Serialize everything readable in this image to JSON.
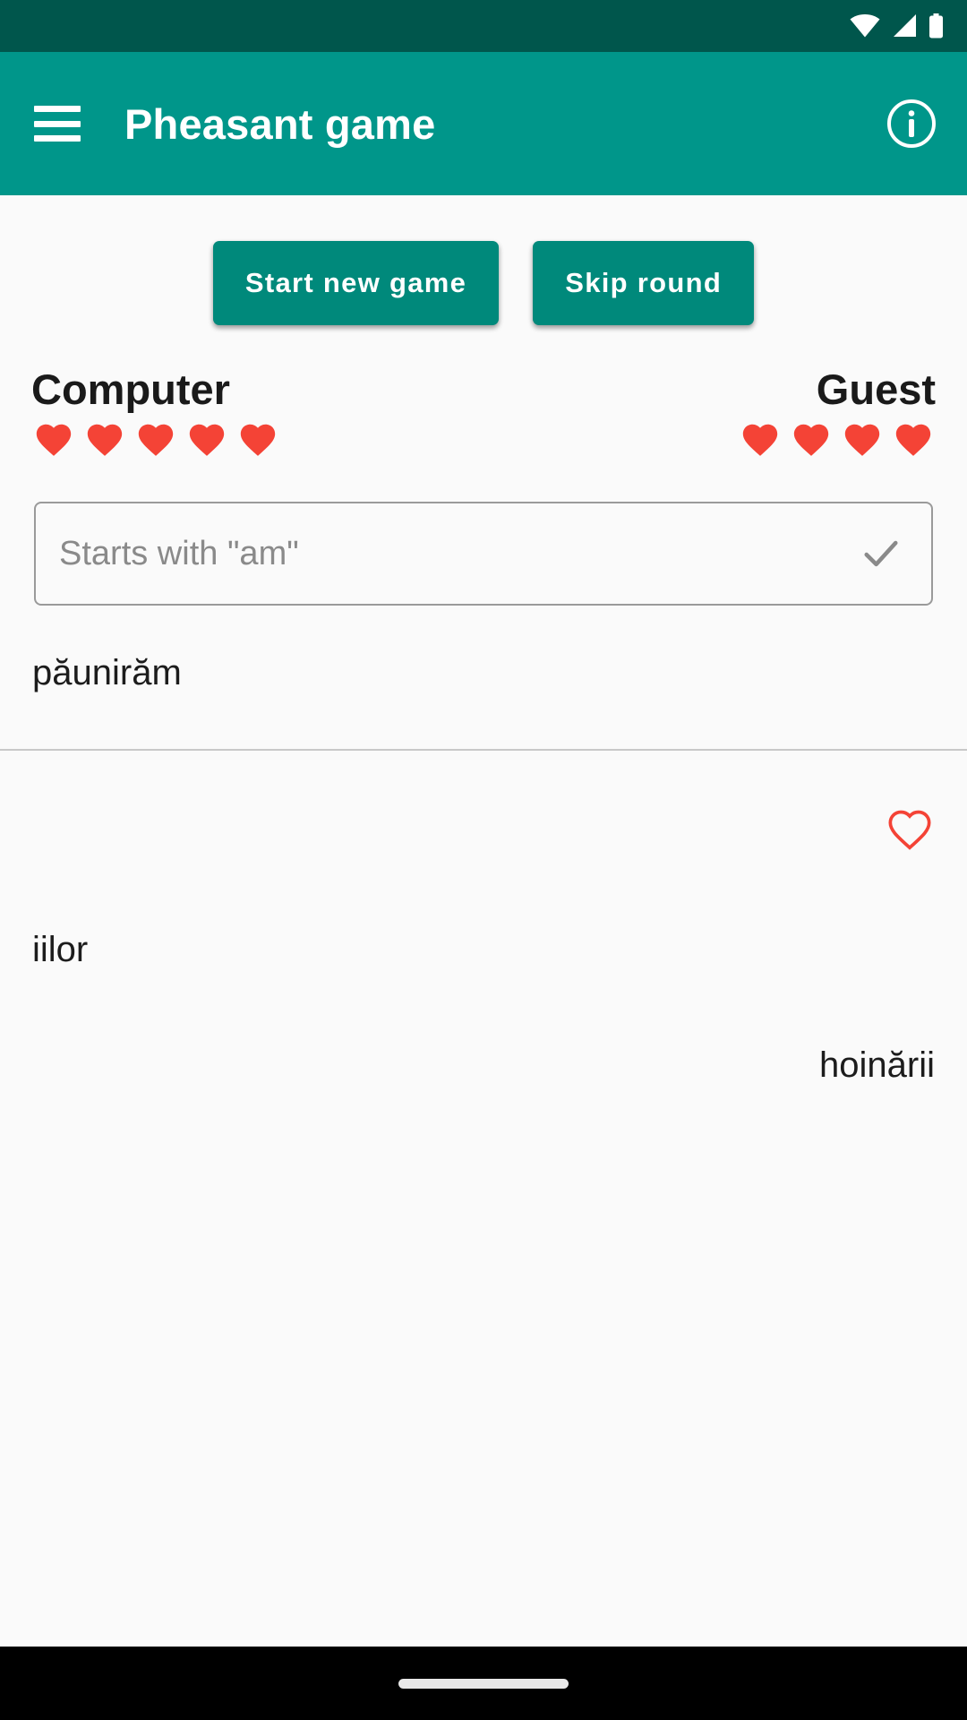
{
  "status_bar": {
    "background": "#00564c",
    "icons": [
      "wifi-icon",
      "cellular-signal-icon",
      "battery-icon"
    ]
  },
  "app_bar": {
    "title": "Pheasant game",
    "background": "#00968a",
    "menu_icon": "hamburger-menu-icon",
    "info_icon": "info-icon"
  },
  "toolbar": {
    "start_new_game_label": "Start new game",
    "skip_round_label": "Skip round",
    "button_color": "#00897b"
  },
  "players": {
    "left": {
      "name": "Computer",
      "lives": 5
    },
    "right": {
      "name": "Guest",
      "lives": 4
    },
    "heart_color": "#f44336"
  },
  "input": {
    "placeholder": "Starts with \"am\"",
    "value": "",
    "submit_icon": "check-icon"
  },
  "current_word": "păunirăm",
  "history": {
    "life_lost_icon": "heart-outline-icon",
    "entries": [
      {
        "text": "iilor",
        "side": "left"
      },
      {
        "text": "hoinării",
        "side": "right"
      }
    ]
  },
  "nav_bar": {
    "gesture_pill": "home-gesture-pill"
  }
}
